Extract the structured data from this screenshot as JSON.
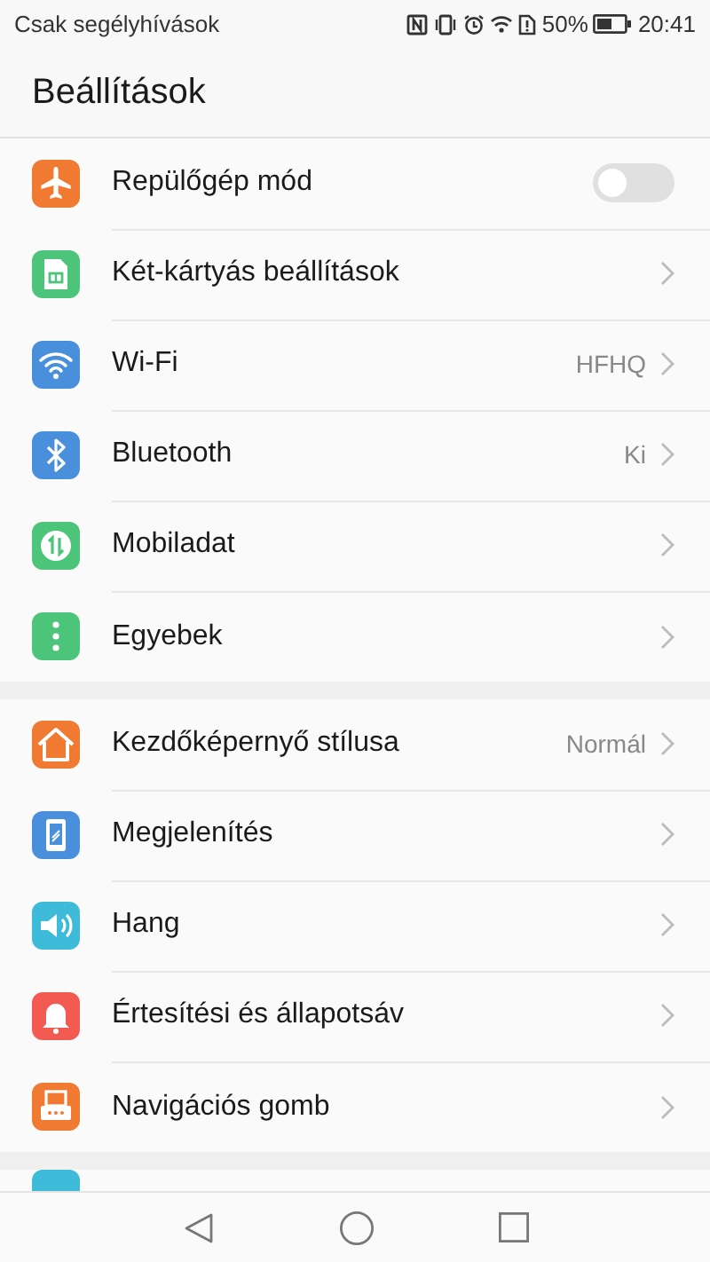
{
  "status_bar": {
    "carrier": "Csak segélyhívások",
    "battery": "50%",
    "time": "20:41"
  },
  "title": "Beállítások",
  "groups": [
    {
      "items": [
        {
          "kind": "toggle",
          "label": "Repülőgép mód",
          "color": "#f07a32",
          "on": false
        },
        {
          "kind": "link",
          "label": "Két-kártyás beállítások",
          "color": "#4cc57a"
        },
        {
          "kind": "link",
          "label": "Wi-Fi",
          "value": "HFHQ",
          "color": "#4a8fdc"
        },
        {
          "kind": "link",
          "label": "Bluetooth",
          "value": "Ki",
          "color": "#4a8fdc"
        },
        {
          "kind": "link",
          "label": "Mobiladat",
          "color": "#4cc57a"
        },
        {
          "kind": "link",
          "label": "Egyebek",
          "color": "#4cc57a"
        }
      ]
    },
    {
      "items": [
        {
          "kind": "link",
          "label": "Kezdőképernyő stílusa",
          "value": "Normál",
          "color": "#f07a32"
        },
        {
          "kind": "link",
          "label": "Megjelenítés",
          "color": "#4a8fdc"
        },
        {
          "kind": "link",
          "label": "Hang",
          "color": "#3dbbd8"
        },
        {
          "kind": "link",
          "label": "Értesítési és állapotsáv",
          "color": "#f25a52"
        },
        {
          "kind": "link",
          "label": "Navigációs gomb",
          "color": "#f07a32"
        }
      ]
    }
  ]
}
